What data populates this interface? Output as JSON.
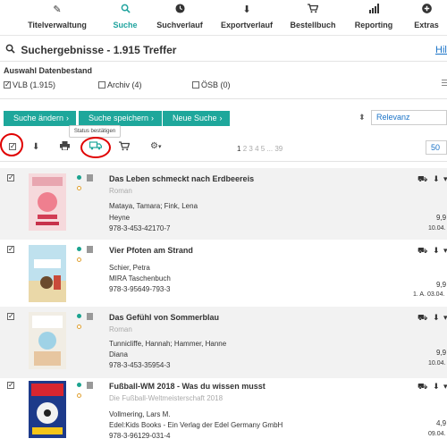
{
  "nav": [
    {
      "label": "Titelverwaltung",
      "icon": "pencil-icon"
    },
    {
      "label": "Suche",
      "icon": "search-icon",
      "active": true
    },
    {
      "label": "Suchverlauf",
      "icon": "clock-icon"
    },
    {
      "label": "Exportverlauf",
      "icon": "download-icon"
    },
    {
      "label": "Bestellbuch",
      "icon": "cart-icon"
    },
    {
      "label": "Reporting",
      "icon": "bar-chart-icon"
    },
    {
      "label": "Extras",
      "icon": "plus-circle-icon"
    }
  ],
  "page_title": "Suchergebnisse - 1.915 Treffer",
  "help_label": "Hilfe",
  "filter": {
    "heading": "Auswahl Datenbestand",
    "options": [
      {
        "label": "VLB (1.915)",
        "checked": true
      },
      {
        "label": "Archiv (4)",
        "checked": false
      },
      {
        "label": "ÖSB (0)",
        "checked": false
      }
    ]
  },
  "actions": {
    "change_search": "Suche ändern",
    "save_search": "Suche speichern",
    "new_search": "Neue Suche"
  },
  "sort": {
    "selected": "Relevanz"
  },
  "tooltip": "Status bestätigen",
  "pagination": {
    "current": "1",
    "pages": [
      "2",
      "3",
      "4",
      "5"
    ],
    "ellipsis": "...",
    "last": "39"
  },
  "per_page": "50",
  "colors": {
    "accent": "#1ea79b",
    "highlight_circle": "#e00000"
  },
  "results": [
    {
      "title": "Das Leben schmeckt nach Erdbeereis",
      "subtitle": "Roman",
      "authors": "Mataya, Tamara; Fink, Lena",
      "publisher": "Heyne",
      "isbn": "978-3-453-42170-7",
      "price": "9,9",
      "date": "10.04."
    },
    {
      "title": "Vier Pfoten am Strand",
      "subtitle": "",
      "authors": "Schier, Petra",
      "publisher": "MIRA Taschenbuch",
      "isbn": "978-3-95649-793-3",
      "price": "9,9",
      "date": "1. A. 03.04."
    },
    {
      "title": "Das Gefühl von Sommerblau",
      "subtitle": "Roman",
      "authors": "Tunnicliffe, Hannah; Hammer, Hanne",
      "publisher": "Diana",
      "isbn": "978-3-453-35954-3",
      "price": "9,9",
      "date": "10.04."
    },
    {
      "title": "Fußball-WM 2018 - Was du wissen musst",
      "subtitle": "Die Fußball-Weltmeisterschaft 2018",
      "authors": "Vollmering, Lars M.",
      "publisher": "Edel:Kids Books - Ein Verlag der Edel Germany GmbH",
      "isbn": "978-3-96129-031-4",
      "price": "4,9",
      "date": "09.04."
    }
  ]
}
